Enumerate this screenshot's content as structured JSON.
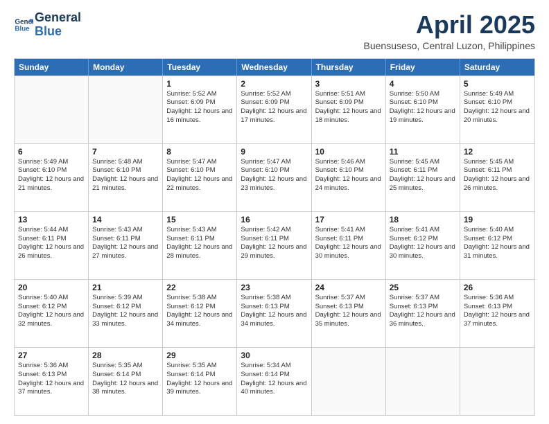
{
  "logo": {
    "line1": "General",
    "line2": "Blue"
  },
  "title": "April 2025",
  "location": "Buensuseso, Central Luzon, Philippines",
  "days_of_week": [
    "Sunday",
    "Monday",
    "Tuesday",
    "Wednesday",
    "Thursday",
    "Friday",
    "Saturday"
  ],
  "weeks": [
    [
      {
        "day": "",
        "info": ""
      },
      {
        "day": "",
        "info": ""
      },
      {
        "day": "1",
        "info": "Sunrise: 5:52 AM\nSunset: 6:09 PM\nDaylight: 12 hours and 16 minutes."
      },
      {
        "day": "2",
        "info": "Sunrise: 5:52 AM\nSunset: 6:09 PM\nDaylight: 12 hours and 17 minutes."
      },
      {
        "day": "3",
        "info": "Sunrise: 5:51 AM\nSunset: 6:09 PM\nDaylight: 12 hours and 18 minutes."
      },
      {
        "day": "4",
        "info": "Sunrise: 5:50 AM\nSunset: 6:10 PM\nDaylight: 12 hours and 19 minutes."
      },
      {
        "day": "5",
        "info": "Sunrise: 5:49 AM\nSunset: 6:10 PM\nDaylight: 12 hours and 20 minutes."
      }
    ],
    [
      {
        "day": "6",
        "info": "Sunrise: 5:49 AM\nSunset: 6:10 PM\nDaylight: 12 hours and 21 minutes."
      },
      {
        "day": "7",
        "info": "Sunrise: 5:48 AM\nSunset: 6:10 PM\nDaylight: 12 hours and 21 minutes."
      },
      {
        "day": "8",
        "info": "Sunrise: 5:47 AM\nSunset: 6:10 PM\nDaylight: 12 hours and 22 minutes."
      },
      {
        "day": "9",
        "info": "Sunrise: 5:47 AM\nSunset: 6:10 PM\nDaylight: 12 hours and 23 minutes."
      },
      {
        "day": "10",
        "info": "Sunrise: 5:46 AM\nSunset: 6:10 PM\nDaylight: 12 hours and 24 minutes."
      },
      {
        "day": "11",
        "info": "Sunrise: 5:45 AM\nSunset: 6:11 PM\nDaylight: 12 hours and 25 minutes."
      },
      {
        "day": "12",
        "info": "Sunrise: 5:45 AM\nSunset: 6:11 PM\nDaylight: 12 hours and 26 minutes."
      }
    ],
    [
      {
        "day": "13",
        "info": "Sunrise: 5:44 AM\nSunset: 6:11 PM\nDaylight: 12 hours and 26 minutes."
      },
      {
        "day": "14",
        "info": "Sunrise: 5:43 AM\nSunset: 6:11 PM\nDaylight: 12 hours and 27 minutes."
      },
      {
        "day": "15",
        "info": "Sunrise: 5:43 AM\nSunset: 6:11 PM\nDaylight: 12 hours and 28 minutes."
      },
      {
        "day": "16",
        "info": "Sunrise: 5:42 AM\nSunset: 6:11 PM\nDaylight: 12 hours and 29 minutes."
      },
      {
        "day": "17",
        "info": "Sunrise: 5:41 AM\nSunset: 6:11 PM\nDaylight: 12 hours and 30 minutes."
      },
      {
        "day": "18",
        "info": "Sunrise: 5:41 AM\nSunset: 6:12 PM\nDaylight: 12 hours and 30 minutes."
      },
      {
        "day": "19",
        "info": "Sunrise: 5:40 AM\nSunset: 6:12 PM\nDaylight: 12 hours and 31 minutes."
      }
    ],
    [
      {
        "day": "20",
        "info": "Sunrise: 5:40 AM\nSunset: 6:12 PM\nDaylight: 12 hours and 32 minutes."
      },
      {
        "day": "21",
        "info": "Sunrise: 5:39 AM\nSunset: 6:12 PM\nDaylight: 12 hours and 33 minutes."
      },
      {
        "day": "22",
        "info": "Sunrise: 5:38 AM\nSunset: 6:12 PM\nDaylight: 12 hours and 34 minutes."
      },
      {
        "day": "23",
        "info": "Sunrise: 5:38 AM\nSunset: 6:13 PM\nDaylight: 12 hours and 34 minutes."
      },
      {
        "day": "24",
        "info": "Sunrise: 5:37 AM\nSunset: 6:13 PM\nDaylight: 12 hours and 35 minutes."
      },
      {
        "day": "25",
        "info": "Sunrise: 5:37 AM\nSunset: 6:13 PM\nDaylight: 12 hours and 36 minutes."
      },
      {
        "day": "26",
        "info": "Sunrise: 5:36 AM\nSunset: 6:13 PM\nDaylight: 12 hours and 37 minutes."
      }
    ],
    [
      {
        "day": "27",
        "info": "Sunrise: 5:36 AM\nSunset: 6:13 PM\nDaylight: 12 hours and 37 minutes."
      },
      {
        "day": "28",
        "info": "Sunrise: 5:35 AM\nSunset: 6:14 PM\nDaylight: 12 hours and 38 minutes."
      },
      {
        "day": "29",
        "info": "Sunrise: 5:35 AM\nSunset: 6:14 PM\nDaylight: 12 hours and 39 minutes."
      },
      {
        "day": "30",
        "info": "Sunrise: 5:34 AM\nSunset: 6:14 PM\nDaylight: 12 hours and 40 minutes."
      },
      {
        "day": "",
        "info": ""
      },
      {
        "day": "",
        "info": ""
      },
      {
        "day": "",
        "info": ""
      }
    ]
  ]
}
